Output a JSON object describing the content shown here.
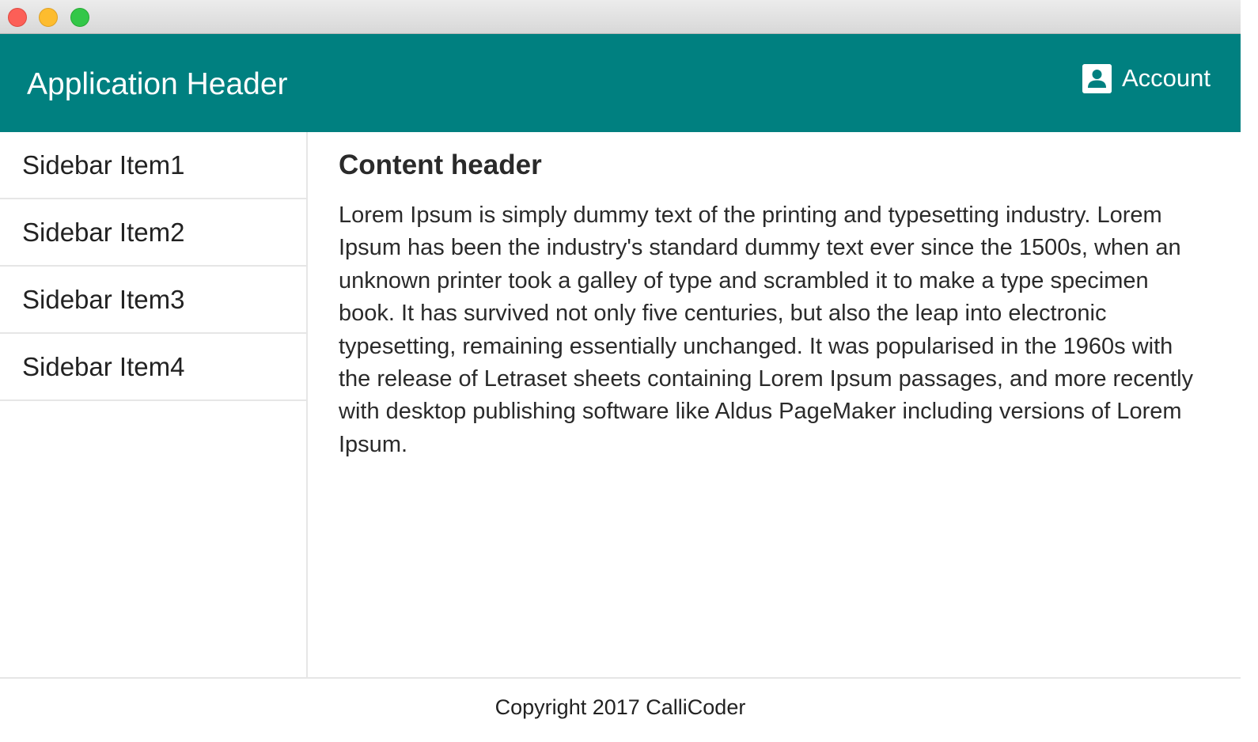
{
  "header": {
    "title": "Application Header",
    "account_label": "Account",
    "account_icon": "account-box-icon",
    "background_color": "#008080"
  },
  "sidebar": {
    "items": [
      {
        "label": "Sidebar Item1"
      },
      {
        "label": "Sidebar Item2"
      },
      {
        "label": "Sidebar Item3"
      },
      {
        "label": "Sidebar Item4"
      }
    ]
  },
  "content": {
    "header": "Content header",
    "body": "Lorem Ipsum is simply dummy text of the printing and typesetting industry. Lorem Ipsum has been the industry's standard dummy text ever since the 1500s, when an unknown printer took a galley of type and scrambled it to make a type specimen book. It has survived not only five centuries, but also the leap into electronic typesetting, remaining essentially unchanged. It was popularised in the 1960s with the release of Letraset sheets containing Lorem Ipsum passages, and more recently with desktop publishing software like Aldus PageMaker including versions of Lorem Ipsum."
  },
  "footer": {
    "text": "Copyright 2017 CalliCoder"
  }
}
